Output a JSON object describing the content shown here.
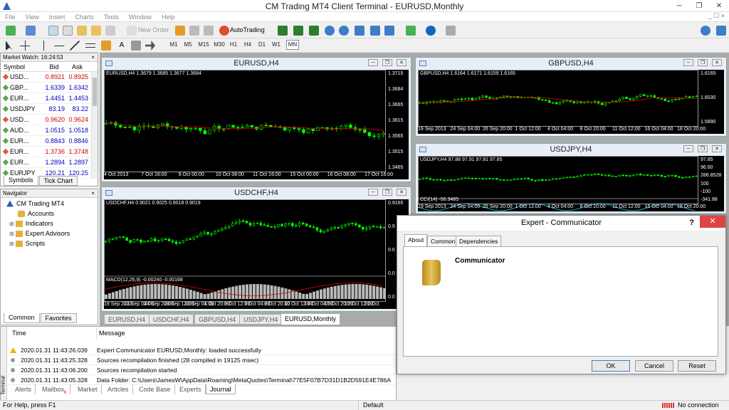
{
  "app": {
    "title": "CM Trading MT4 Client Terminal - EURUSD,Monthly",
    "window_controls": [
      "─",
      "❐",
      "✕"
    ]
  },
  "menu": {
    "items": [
      "File",
      "View",
      "Insert",
      "Charts",
      "Tools",
      "Window",
      "Help"
    ],
    "right_label": "_ ☐ ×"
  },
  "toolbar": {
    "new_order": "New Order",
    "autotrading": "AutoTrading",
    "timeframes": [
      "M1",
      "M5",
      "M15",
      "M30",
      "H1",
      "H4",
      "D1",
      "W1",
      "MN"
    ],
    "selected_timeframe": "MN"
  },
  "market_watch": {
    "title": "Market Watch: 16:24:53",
    "close": "×",
    "columns": [
      "Symbol",
      "Bid",
      "Ask"
    ],
    "rows": [
      {
        "symbol": "USD...",
        "bid": "0.8921",
        "ask": "0.8925",
        "color": "red"
      },
      {
        "symbol": "GBP...",
        "bid": "1.6339",
        "ask": "1.6342",
        "color": "blue"
      },
      {
        "symbol": "EUR...",
        "bid": "1.4451",
        "ask": "1.4453",
        "color": "blue"
      },
      {
        "symbol": "USDJPY",
        "bid": "83.19",
        "ask": "83.22",
        "color": "blue"
      },
      {
        "symbol": "USD...",
        "bid": "0.9620",
        "ask": "0.9624",
        "color": "red"
      },
      {
        "symbol": "AUD...",
        "bid": "1.0515",
        "ask": "1.0518",
        "color": "blue"
      },
      {
        "symbol": "EUR...",
        "bid": "0.8843",
        "ask": "0.8846",
        "color": "blue"
      },
      {
        "symbol": "EUR...",
        "bid": "1.3736",
        "ask": "1.3748",
        "color": "red"
      },
      {
        "symbol": "EUR...",
        "bid": "1.2894",
        "ask": "1.2897",
        "color": "blue"
      },
      {
        "symbol": "EURJPY",
        "bid": "120.21",
        "ask": "120.25",
        "color": "blue"
      }
    ],
    "tabs": [
      "Symbols",
      "Tick Chart"
    ]
  },
  "navigator": {
    "title": "Navigator",
    "close": "×",
    "root": "CM Trading MT4",
    "items": [
      "Accounts",
      "Indicators",
      "Expert Advisors",
      "Scripts"
    ],
    "tabs": [
      "Common",
      "Favorites"
    ]
  },
  "charts": [
    {
      "window_title": "EURUSD,H4",
      "info": "EURUSD,H4  1.3679 1.3685 1.3677 1.3684",
      "price_labels": [
        "1.3715",
        "1.3684",
        "1.3665",
        "1.3615",
        "1.3565",
        "1.3515",
        "1.3465"
      ],
      "time_labels": [
        "4 Oct 2013",
        "7 Oct 16:00",
        "9 Oct 00:00",
        "10 Oct 08:00",
        "11 Oct 16:00",
        "15 Oct 00:00",
        "16 Oct 08:00",
        "17 Oct 16:00"
      ]
    },
    {
      "window_title": "GBPUSD,H4",
      "info": "GBPUSD,H4  1.6164 1.6171 1.6159 1.6165",
      "price_labels": [
        "1.6165",
        "1.6030",
        "1.5890"
      ],
      "time_labels": [
        "19 Sep 2013",
        "24 Sep 04:00",
        "26 Sep 20:00",
        "1 Oct 12:00",
        "4 Oct 04:00",
        "8 Oct 20:00",
        "11 Oct 12:00",
        "16 Oct 04:00",
        "18 Oct 20:00"
      ]
    },
    {
      "window_title": "USDJPY,H4",
      "info": "USDJPY,H4  97.88 97.91 97.81 97.85",
      "indicator_info": "CCI(14) -56.3485",
      "price_labels": [
        "97.85",
        "96.60",
        "286.8528",
        "100",
        "-100",
        "-341.88"
      ],
      "time_labels": [
        "19 Sep 2013",
        "24 Sep 04:00",
        "26 Sep 20:00",
        "1 Oct 12:00",
        "4 Oct 04:00",
        "8 Oct 20:00",
        "11 Oct 12:00",
        "16 Oct 04:00",
        "18 Oct 20:00"
      ]
    },
    {
      "window_title": "USDCHF,H4",
      "info": "USDCHF,H4  0.9021 0.9025 0.9018 0.9019",
      "indicator_info": "MACD(12,26,9) -0.00240 -0.00168",
      "price_labels": [
        "0.9165",
        "0.9",
        "0.0",
        "0.0",
        "0.0"
      ],
      "time_labels": [
        "19 Sep 2013",
        "23 Sep 04:00",
        "24 Sep 20:00",
        "26 Sep 12:00",
        "30 Sep 04:00",
        "1 Oct 20:00",
        "3 Oct 12:00",
        "7 Oct 04:00",
        "8 Oct 20:00",
        "10 Oct 12:00",
        "14 Oct 04:00",
        "15 Oct 20:00",
        "17 Oct 12:00",
        "21 Oct"
      ]
    }
  ],
  "chart_tabs": [
    "EURUSD,H4",
    "USDCHF,H4",
    "GBPUSD,H4",
    "USDJPY,H4",
    "EURUSD,Monthly"
  ],
  "active_chart_tab": "EURUSD,Monthly",
  "terminal": {
    "side_label": "Terminal",
    "columns": [
      "Time",
      "Message"
    ],
    "rows": [
      {
        "time": "2020.01.31 11:43:26.039",
        "message": "Expert Communicator EURUSD,Monthly: loaded successfully",
        "icon": "warning"
      },
      {
        "time": "2020.01.31 11:43:25.328",
        "message": "Sources recompilation finished (28 compiled in 19125 msec)",
        "icon": "info"
      },
      {
        "time": "2020.01.31 11:43:06.200",
        "message": "Sources recompilation started",
        "icon": "info"
      },
      {
        "time": "2020.01.31 11:43:05.328",
        "message": "Data Folder: C:\\Users\\JamesW\\AppData\\Roaming\\MetaQuotes\\Terminal\\77E5F07B7D31D1B2D591E4E786A",
        "icon": "info"
      }
    ],
    "tabs": [
      "Alerts",
      "Mailbox",
      "Market",
      "Articles",
      "Code Base",
      "Experts",
      "Journal"
    ],
    "mailbox_badge": "6",
    "active_tab": "Journal"
  },
  "status": {
    "help": "For Help, press F1",
    "profile": "Default",
    "connection": "No connection"
  },
  "dialog": {
    "title": "Expert - Communicator",
    "help": "?",
    "close": "✕",
    "tabs": [
      "About",
      "Common",
      "Dependencies"
    ],
    "active_tab": "About",
    "expert_name": "Communicator",
    "buttons": {
      "ok": "OK",
      "cancel": "Cancel",
      "reset": "Reset"
    }
  },
  "colors": {
    "bull": "#00ff00",
    "bear": "#00ff00",
    "ma_line": "#c00000",
    "bid_red": "#d00000",
    "bid_blue": "#0000c0",
    "close_red": "#e04343",
    "scroll_yellow": "#c8a02a"
  }
}
